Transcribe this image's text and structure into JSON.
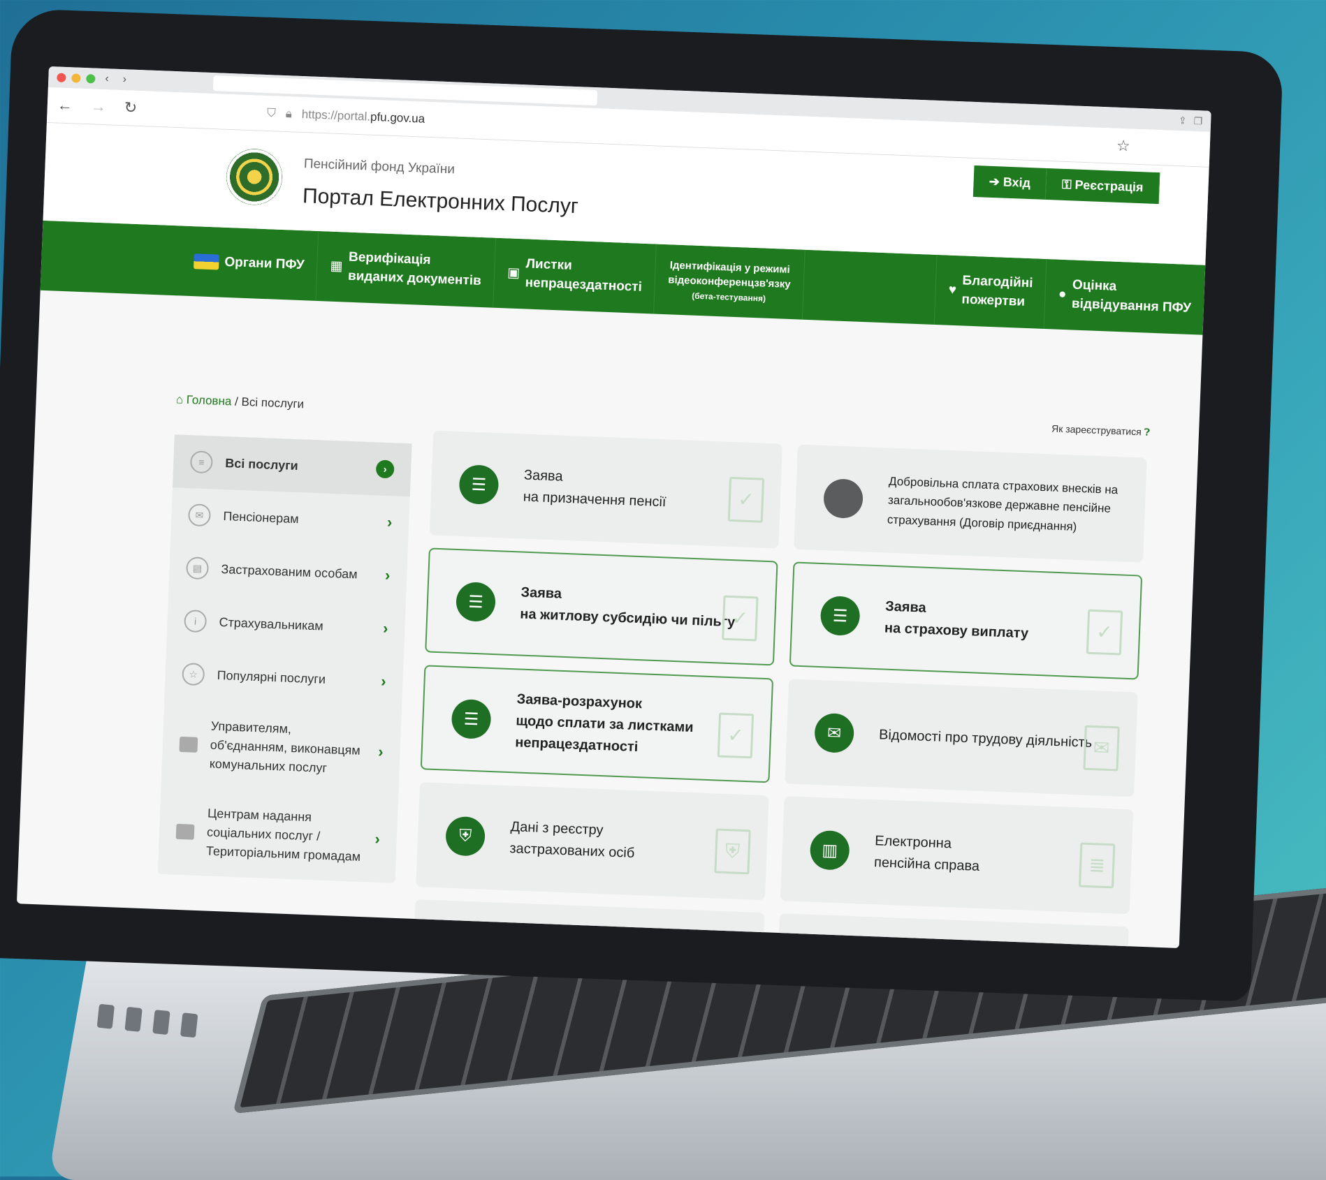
{
  "browser": {
    "nav_back": "‹",
    "nav_forward": "›",
    "url_prefix": "https://portal.",
    "url_domain": "pfu.gov.ua"
  },
  "header": {
    "org_name": "Пенсійний фонд України",
    "portal_name": "Портал Електронних Послуг",
    "login_label": "Вхід",
    "register_label": "Реєстрація"
  },
  "nav": {
    "items": [
      {
        "label": "Органи ПФУ"
      },
      {
        "label_line1": "Верифікація",
        "label_line2": "виданих документів"
      },
      {
        "label_line1": "Листки",
        "label_line2": "непрацездатності"
      },
      {
        "label_line1": "Ідентифікація у режимі",
        "label_line2": "відеоконференцзв'язку",
        "label_line3": "(бета-тестування)"
      },
      {
        "label_line1": "Благодійні",
        "label_line2": "пожертви"
      },
      {
        "label_line1": "Оцінка",
        "label_line2": "відвідування ПФУ"
      }
    ]
  },
  "breadcrumb": {
    "home": "Головна",
    "separator": "/",
    "current": "Всі послуги",
    "how_to_register": "Як зареєструватися"
  },
  "sidebar": {
    "items": [
      {
        "label": "Всі послуги",
        "icon": "list-icon"
      },
      {
        "label": "Пенсіонерам",
        "icon": "envelope-icon"
      },
      {
        "label": "Застрахованим особам",
        "icon": "document-icon"
      },
      {
        "label": "Страхувальникам",
        "icon": "info-icon"
      },
      {
        "label": "Популярні послуги",
        "icon": "star-icon"
      },
      {
        "label": "Управителям, об'єднанням, виконавцям комунальних послуг",
        "icon": "folder-icon"
      },
      {
        "label": "Центрам надання соціальних послуг / Територіальним громадам",
        "icon": "folder-icon"
      }
    ]
  },
  "cards": [
    {
      "line1": "Заява",
      "line2": "на призначення пенсії"
    },
    {
      "line1": "Добровільна сплата страхових внесків на загальнообов'язкове державне пенсійне страхування (Договір приєднання)"
    },
    {
      "line1": "Заява",
      "line2": "на житлову субсидію чи пільгу"
    },
    {
      "line1": "Заява",
      "line2": "на страхову виплату"
    },
    {
      "line1": "Заява-розрахунок",
      "line2": "щодо сплати за листками",
      "line3": "непрацездатності"
    },
    {
      "line1": "Відомості про трудову діяльність"
    },
    {
      "line1": "Дані з реєстру",
      "line2": "застрахованих осіб"
    },
    {
      "line1": "Електронна",
      "line2": "пенсійна справа"
    }
  ],
  "colors": {
    "brand_green": "#1f7a1f",
    "icon_green": "#1e6e24"
  }
}
